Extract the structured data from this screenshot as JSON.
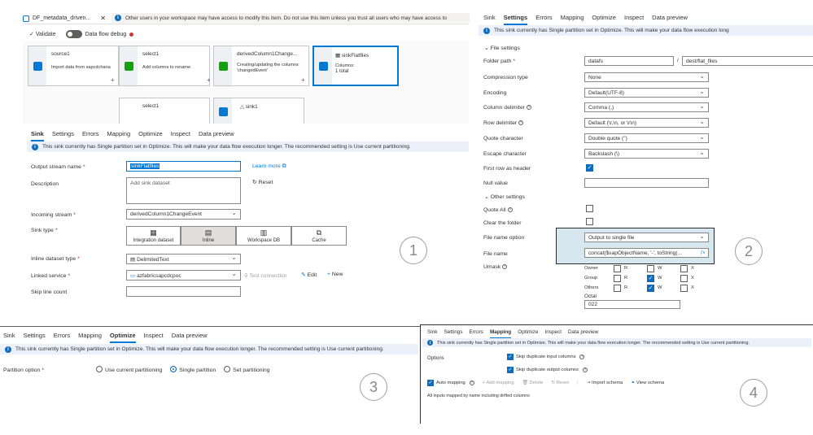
{
  "colors": {
    "accent": "#0078d4",
    "info_bg": "#eaf1fb",
    "required": "#a4262c",
    "error_dot": "#d13438"
  },
  "top": {
    "tab_title": "DF_metadata_driven...",
    "notice": "Other users in your workspace may have access to modify this item. Do not use this item unless you trust all users who may have access to",
    "validate": "Validate",
    "debug": "Data flow debug"
  },
  "flow": {
    "nodes": [
      {
        "title": "source1",
        "desc": "Import data from sapcdchana"
      },
      {
        "title": "select1",
        "desc": "Add columns to rename"
      },
      {
        "title": "derivedColumn1Change...",
        "desc": "Creating/updating the columns 'changedEvent'"
      },
      {
        "title": "sinkFlatfiles",
        "desc": "Columns:",
        "count": "1 total"
      },
      {
        "title": "select1",
        "desc": ""
      },
      {
        "title": "sink1",
        "desc": ""
      }
    ]
  },
  "tabs": [
    "Sink",
    "Settings",
    "Errors",
    "Mapping",
    "Optimize",
    "Inspect",
    "Data preview"
  ],
  "info_message": "This sink currently has Single partition set in Optimize. This will make your data flow execution longer. The recommended setting is Use current partitioning.",
  "info_message_short": "This sink currently has Single partition set in Optimize. This will make your data flow execution long",
  "panel1": {
    "output_stream_label": "Output stream name",
    "output_stream_value": "sinkFlatfiles",
    "learn_more": "Learn more",
    "description_label": "Description",
    "description_placeholder": "Add sink dataset",
    "reset": "Reset",
    "incoming_label": "Incoming stream",
    "incoming_value": "derivedColumn1ChangeEvent",
    "sink_type_label": "Sink type",
    "sink_types": [
      "Integration dataset",
      "Inline",
      "Workspace DB",
      "Cache"
    ],
    "inline_type_label": "Inline dataset type",
    "inline_type_value": "DelimitedText",
    "linked_label": "Linked service",
    "linked_value": "azfabricsapcdcpoc",
    "test_connection": "Test connection",
    "edit": "Edit",
    "new": "New",
    "skip_label": "Skip line count",
    "marker": "1"
  },
  "panel2": {
    "file_settings": "File settings",
    "folder_path_label": "Folder path",
    "folder_path_a": "datafs",
    "folder_path_b": "dest/flat_files",
    "compression_label": "Compression type",
    "compression_value": "None",
    "encoding_label": "Encoding",
    "encoding_value": "Default(UTF-8)",
    "col_delim_label": "Column delimiter",
    "col_delim_value": "Comma (,)",
    "row_delim_label": "Row delimiter",
    "row_delim_value": "Default (\\r,\\n, or \\r\\n)",
    "quote_label": "Quote character",
    "quote_value": "Double quote (\")",
    "escape_label": "Escape character",
    "escape_value": "Backslash (\\)",
    "first_row_label": "First row as header",
    "null_label": "Null value",
    "other_settings": "Other settings",
    "quote_all_label": "Quote All",
    "clear_folder_label": "Clear the folder",
    "file_name_option_label": "File name option",
    "file_name_option_value": "Output to single file",
    "file_name_label": "File name",
    "file_name_value": "concat($sapObjectName, '-', toString(...",
    "umask_label": "Umask",
    "umask_rows": [
      "Owner",
      "Group",
      "Others"
    ],
    "perms": [
      "R",
      "W",
      "X"
    ],
    "octal_label": "Octal",
    "octal_value": "022",
    "marker": "2"
  },
  "panel3": {
    "partition_label": "Partition option",
    "options": [
      "Use current partitioning",
      "Single partition",
      "Set partitioning"
    ],
    "marker": "3"
  },
  "panel4": {
    "options_label": "Options",
    "skip_input": "Skip duplicate input columns",
    "skip_output": "Skip duplicate output columns",
    "auto_mapping": "Auto mapping",
    "add_mapping": "Add mapping",
    "delete": "Delete",
    "reset": "Reset",
    "import_schema": "Import schema",
    "view_schema": "View schema",
    "note": "All inputs mapped by name including drifted columns",
    "marker": "4"
  }
}
